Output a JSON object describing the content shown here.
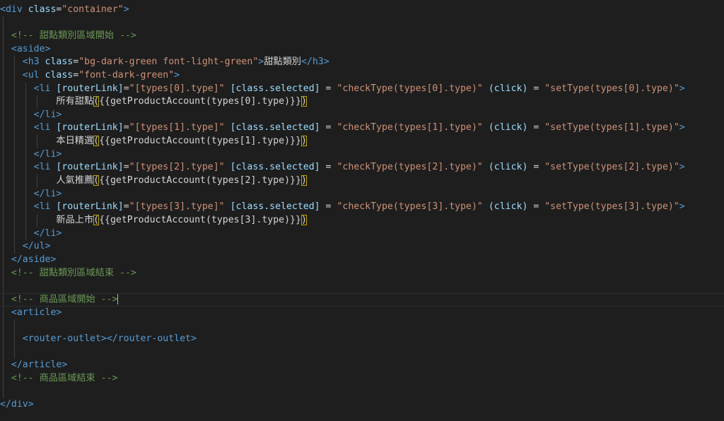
{
  "lines": [
    {
      "segments": [
        {
          "t": "<div",
          "c": "tag"
        },
        {
          "t": " class",
          "c": "attr"
        },
        {
          "t": "=",
          "c": "txt"
        },
        {
          "t": "\"container\"",
          "c": "str"
        },
        {
          "t": ">",
          "c": "tag"
        }
      ]
    },
    {
      "segments": []
    },
    {
      "segments": [
        {
          "t": "  "
        },
        {
          "t": "<!-- 甜點類別區域開始 -->",
          "c": "cmt"
        }
      ]
    },
    {
      "segments": [
        {
          "t": "  "
        },
        {
          "t": "<aside>",
          "c": "tag"
        }
      ]
    },
    {
      "segments": [
        {
          "t": "    "
        },
        {
          "t": "<h3",
          "c": "tag"
        },
        {
          "t": " class",
          "c": "attr"
        },
        {
          "t": "=",
          "c": "txt"
        },
        {
          "t": "\"bg-dark-green font-light-green\"",
          "c": "str"
        },
        {
          "t": ">",
          "c": "tag"
        },
        {
          "t": "甜點類別",
          "c": "txt"
        },
        {
          "t": "</h3>",
          "c": "tag"
        }
      ]
    },
    {
      "segments": [
        {
          "t": "    "
        },
        {
          "t": "<ul",
          "c": "tag"
        },
        {
          "t": " class",
          "c": "attr"
        },
        {
          "t": "=",
          "c": "txt"
        },
        {
          "t": "\"font-dark-green\"",
          "c": "str"
        },
        {
          "t": ">",
          "c": "tag"
        }
      ]
    },
    {
      "segments": [
        {
          "t": "      "
        },
        {
          "t": "<li",
          "c": "tag"
        },
        {
          "t": " [routerLink]",
          "c": "attr"
        },
        {
          "t": "=",
          "c": "txt"
        },
        {
          "t": "\"[types[0].type]\"",
          "c": "str"
        },
        {
          "t": " [class.selected]",
          "c": "attr"
        },
        {
          "t": " = ",
          "c": "txt"
        },
        {
          "t": "\"checkType(types[0].type)\"",
          "c": "str"
        },
        {
          "t": " (click)",
          "c": "attr"
        },
        {
          "t": " = ",
          "c": "txt"
        },
        {
          "t": "\"setType(types[0].type)\"",
          "c": "str"
        },
        {
          "t": ">",
          "c": "tag"
        }
      ]
    },
    {
      "segments": [
        {
          "t": "          "
        },
        {
          "t": "所有甜點",
          "c": "txt"
        },
        {
          "t": "(",
          "c": "txt",
          "ob": true
        },
        {
          "t": "{{getProductAccount(types[0].type)}}",
          "c": "txt"
        },
        {
          "t": ")",
          "c": "txt",
          "ob": true
        }
      ]
    },
    {
      "segments": [
        {
          "t": "      "
        },
        {
          "t": "</li>",
          "c": "tag"
        }
      ]
    },
    {
      "segments": [
        {
          "t": "      "
        },
        {
          "t": "<li",
          "c": "tag"
        },
        {
          "t": " [routerLink]",
          "c": "attr"
        },
        {
          "t": "=",
          "c": "txt"
        },
        {
          "t": "\"[types[1].type]\"",
          "c": "str"
        },
        {
          "t": " [class.selected]",
          "c": "attr"
        },
        {
          "t": " = ",
          "c": "txt"
        },
        {
          "t": "\"checkType(types[1].type)\"",
          "c": "str"
        },
        {
          "t": " (click)",
          "c": "attr"
        },
        {
          "t": " = ",
          "c": "txt"
        },
        {
          "t": "\"setType(types[1].type)\"",
          "c": "str"
        },
        {
          "t": ">",
          "c": "tag"
        }
      ]
    },
    {
      "segments": [
        {
          "t": "          "
        },
        {
          "t": "本日精選",
          "c": "txt"
        },
        {
          "t": "(",
          "c": "txt",
          "ob": true
        },
        {
          "t": "{{getProductAccount(types[1].type)}}",
          "c": "txt"
        },
        {
          "t": ")",
          "c": "txt",
          "ob": true
        }
      ]
    },
    {
      "segments": [
        {
          "t": "      "
        },
        {
          "t": "</li>",
          "c": "tag"
        }
      ]
    },
    {
      "segments": [
        {
          "t": "      "
        },
        {
          "t": "<li",
          "c": "tag"
        },
        {
          "t": " [routerLink]",
          "c": "attr"
        },
        {
          "t": "=",
          "c": "txt"
        },
        {
          "t": "\"[types[2].type]\"",
          "c": "str"
        },
        {
          "t": " [class.selected]",
          "c": "attr"
        },
        {
          "t": " = ",
          "c": "txt"
        },
        {
          "t": "\"checkType(types[2].type)\"",
          "c": "str"
        },
        {
          "t": " (click)",
          "c": "attr"
        },
        {
          "t": " = ",
          "c": "txt"
        },
        {
          "t": "\"setType(types[2].type)\"",
          "c": "str"
        },
        {
          "t": ">",
          "c": "tag"
        }
      ]
    },
    {
      "segments": [
        {
          "t": "          "
        },
        {
          "t": "人氣推薦",
          "c": "txt"
        },
        {
          "t": "(",
          "c": "txt",
          "ob": true
        },
        {
          "t": "{{getProductAccount(types[2].type)}}",
          "c": "txt"
        },
        {
          "t": ")",
          "c": "txt",
          "ob": true
        }
      ]
    },
    {
      "segments": [
        {
          "t": "      "
        },
        {
          "t": "</li>",
          "c": "tag"
        }
      ]
    },
    {
      "segments": [
        {
          "t": "      "
        },
        {
          "t": "<li",
          "c": "tag"
        },
        {
          "t": " [routerLink]",
          "c": "attr"
        },
        {
          "t": "=",
          "c": "txt"
        },
        {
          "t": "\"[types[3].type]\"",
          "c": "str"
        },
        {
          "t": " [class.selected]",
          "c": "attr"
        },
        {
          "t": " = ",
          "c": "txt"
        },
        {
          "t": "\"checkType(types[3].type)\"",
          "c": "str"
        },
        {
          "t": " (click)",
          "c": "attr"
        },
        {
          "t": " = ",
          "c": "txt"
        },
        {
          "t": "\"setType(types[3].type)\"",
          "c": "str"
        },
        {
          "t": ">",
          "c": "tag"
        }
      ]
    },
    {
      "segments": [
        {
          "t": "          "
        },
        {
          "t": "新品上市",
          "c": "txt"
        },
        {
          "t": "(",
          "c": "txt",
          "ob": true
        },
        {
          "t": "{{getProductAccount(types[3].type)}}",
          "c": "txt"
        },
        {
          "t": ")",
          "c": "txt",
          "ob": true
        }
      ]
    },
    {
      "segments": [
        {
          "t": "      "
        },
        {
          "t": "</li>",
          "c": "tag"
        }
      ]
    },
    {
      "segments": [
        {
          "t": "    "
        },
        {
          "t": "</ul>",
          "c": "tag"
        }
      ]
    },
    {
      "segments": [
        {
          "t": "  "
        },
        {
          "t": "</aside>",
          "c": "tag"
        }
      ]
    },
    {
      "segments": [
        {
          "t": "  "
        },
        {
          "t": "<!-- 甜點類別區域結束 -->",
          "c": "cmt"
        }
      ]
    },
    {
      "segments": []
    },
    {
      "segments": [
        {
          "t": "  "
        },
        {
          "t": "<!-- 商品區域開始 -->",
          "c": "cmt"
        }
      ],
      "cursor": true
    },
    {
      "segments": [
        {
          "t": "  "
        },
        {
          "t": "<article>",
          "c": "tag"
        }
      ]
    },
    {
      "segments": []
    },
    {
      "segments": [
        {
          "t": "    "
        },
        {
          "t": "<router-outlet></router-outlet>",
          "c": "tag"
        }
      ]
    },
    {
      "segments": []
    },
    {
      "segments": [
        {
          "t": "  "
        },
        {
          "t": "</article>",
          "c": "tag"
        }
      ]
    },
    {
      "segments": [
        {
          "t": "  "
        },
        {
          "t": "<!-- 商品區域結束 -->",
          "c": "cmt"
        }
      ]
    },
    {
      "segments": []
    },
    {
      "segments": [
        {
          "t": "</div>",
          "c": "tag"
        }
      ]
    }
  ],
  "current_line": 22,
  "colors": {
    "background": "#1e1e1e",
    "tag": "#569cd6",
    "attribute": "#9cdcfe",
    "string": "#ce9178",
    "comment": "#6a9955",
    "text": "#d4d4d4",
    "bracket_highlight": "#c8a200"
  }
}
